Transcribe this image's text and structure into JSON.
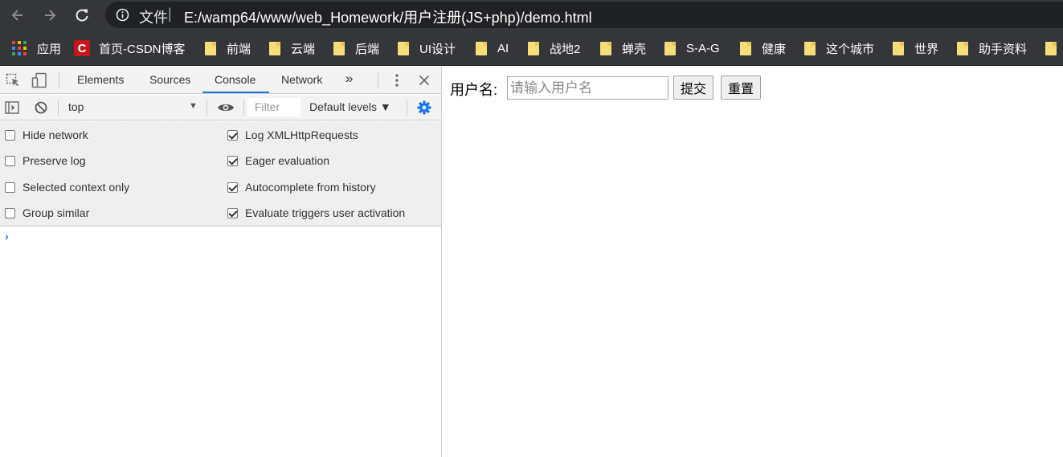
{
  "browser": {
    "url_scheme_label": "文件",
    "url_separator": "|",
    "url": "E:/wamp64/www/web_Homework/用户注册(JS+php)/demo.html"
  },
  "bookmarks": [
    {
      "label": "应用",
      "icon": "apps-grid-icon"
    },
    {
      "label": "首页-CSDN博客",
      "icon": "csdn-logo-icon",
      "logo_text": "C"
    },
    {
      "label": "前端",
      "icon": "folder-icon"
    },
    {
      "label": "云端",
      "icon": "folder-icon"
    },
    {
      "label": "后端",
      "icon": "folder-icon"
    },
    {
      "label": "UI设计",
      "icon": "folder-icon"
    },
    {
      "label": "AI",
      "icon": "folder-icon"
    },
    {
      "label": "战地2",
      "icon": "folder-icon"
    },
    {
      "label": "蝉壳",
      "icon": "folder-icon"
    },
    {
      "label": "S-A-G",
      "icon": "folder-icon"
    },
    {
      "label": "健康",
      "icon": "folder-icon"
    },
    {
      "label": "这个城市",
      "icon": "folder-icon"
    },
    {
      "label": "世界",
      "icon": "folder-icon"
    },
    {
      "label": "助手资料",
      "icon": "folder-icon"
    }
  ],
  "devtools": {
    "tabs": [
      "Elements",
      "Sources",
      "Console",
      "Network"
    ],
    "active_tab": "Console",
    "more_tabs_glyph": "»",
    "context": "top",
    "context_arrow": "▼",
    "filter_placeholder": "Filter",
    "levels": "Default levels ▼",
    "options_left": [
      {
        "label": "Hide network",
        "checked": false
      },
      {
        "label": "Preserve log",
        "checked": false
      },
      {
        "label": "Selected context only",
        "checked": false
      },
      {
        "label": "Group similar",
        "checked": false
      }
    ],
    "options_right": [
      {
        "label": "Log XMLHttpRequests",
        "checked": true
      },
      {
        "label": "Eager evaluation",
        "checked": true
      },
      {
        "label": "Autocomplete from history",
        "checked": true
      },
      {
        "label": "Evaluate triggers user activation",
        "checked": true
      }
    ],
    "prompt_glyph": "›"
  },
  "page": {
    "username_label": "用户名:",
    "username_placeholder": "请输入用户名",
    "submit_label": "提交",
    "reset_label": "重置"
  },
  "colors": {
    "chrome_bar": "#35363a",
    "omnibox": "#202124",
    "devtools_accent": "#1a73e8",
    "folder": "#f7dc7a",
    "csdn_red": "#c8161d"
  }
}
